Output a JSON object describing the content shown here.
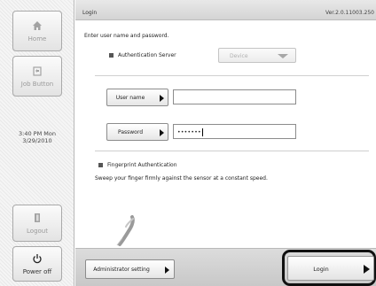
{
  "sidebar": {
    "home_label": "Home",
    "job_label": "Job Button",
    "clock_time": "3:40 PM  Mon",
    "clock_date": "3/29/2010",
    "logout_label": "Logout",
    "power_label": "Power off"
  },
  "header": {
    "title": "Login",
    "version": "Ver.2.0.11003.250"
  },
  "main": {
    "instruction": "Enter user name and password.",
    "auth_server_label": "Authentication Server",
    "auth_server_value": "Device",
    "username_button": "User name",
    "username_value": "",
    "password_button": "Password",
    "password_value": "•••••••",
    "fingerprint_label": "Fingerprint Authentication",
    "fingerprint_instruction": "Sweep your finger firmly against the sensor at a constant speed."
  },
  "footer": {
    "admin_button": "Administrator setting",
    "login_button": "Login"
  },
  "icons": {
    "home": "home-icon",
    "job": "job-button-icon",
    "logout": "logout-icon",
    "power": "power-icon",
    "fingerprint": "finger-swipe-icon"
  }
}
